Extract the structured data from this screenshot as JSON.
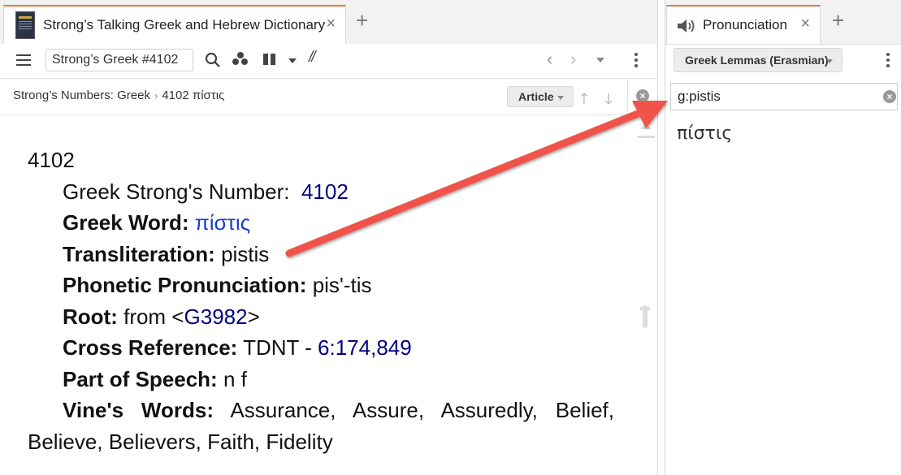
{
  "left_panel": {
    "tab_title": "Strong’s Talking Greek and Hebrew Dictionary",
    "reference_value": "Strong’s Greek #4102",
    "breadcrumb": {
      "resource": "Strong’s Numbers: Greek",
      "separator": "›",
      "entry": "4102 πίστις"
    },
    "article_button": "Article",
    "entry": {
      "number": "4102",
      "strongs_label": "Greek Strong's Number:",
      "strongs_value": "4102",
      "greek_word_label": "Greek Word:",
      "greek_word_value": "πίστις",
      "translit_label": "Transliteration:",
      "translit_value": "pistis",
      "phonetic_label": "Phonetic Pronunciation:",
      "phonetic_value": "pis'-tis",
      "root_label": "Root:",
      "root_prefix": "from <",
      "root_link": "G3982",
      "root_suffix": ">",
      "crossref_label": "Cross Reference:",
      "crossref_prefix": "TDNT - ",
      "crossref_link": "6:174,849",
      "pos_label": "Part of Speech:",
      "pos_value": "n f",
      "vine_label": "Vine's Words:",
      "vine_value": "Assurance, Assure, Assuredly, Belief, Believe, Believers, Faith, Fidelity"
    }
  },
  "right_panel": {
    "tab_title": "Pronunciation",
    "lemma_button": "Greek Lemmas (Erasmian)",
    "search_value": "g:pistis",
    "result_word": "πίστις"
  },
  "icons": {
    "close": "×",
    "plus": "+",
    "back": "‹",
    "forward": "›",
    "up": "🡑",
    "down": "🡓",
    "sync": "//"
  },
  "colors": {
    "tab_accent": "#f07828",
    "link": "#00007f",
    "greek_link": "#1a3bcc",
    "arrow": "#f0534a"
  }
}
